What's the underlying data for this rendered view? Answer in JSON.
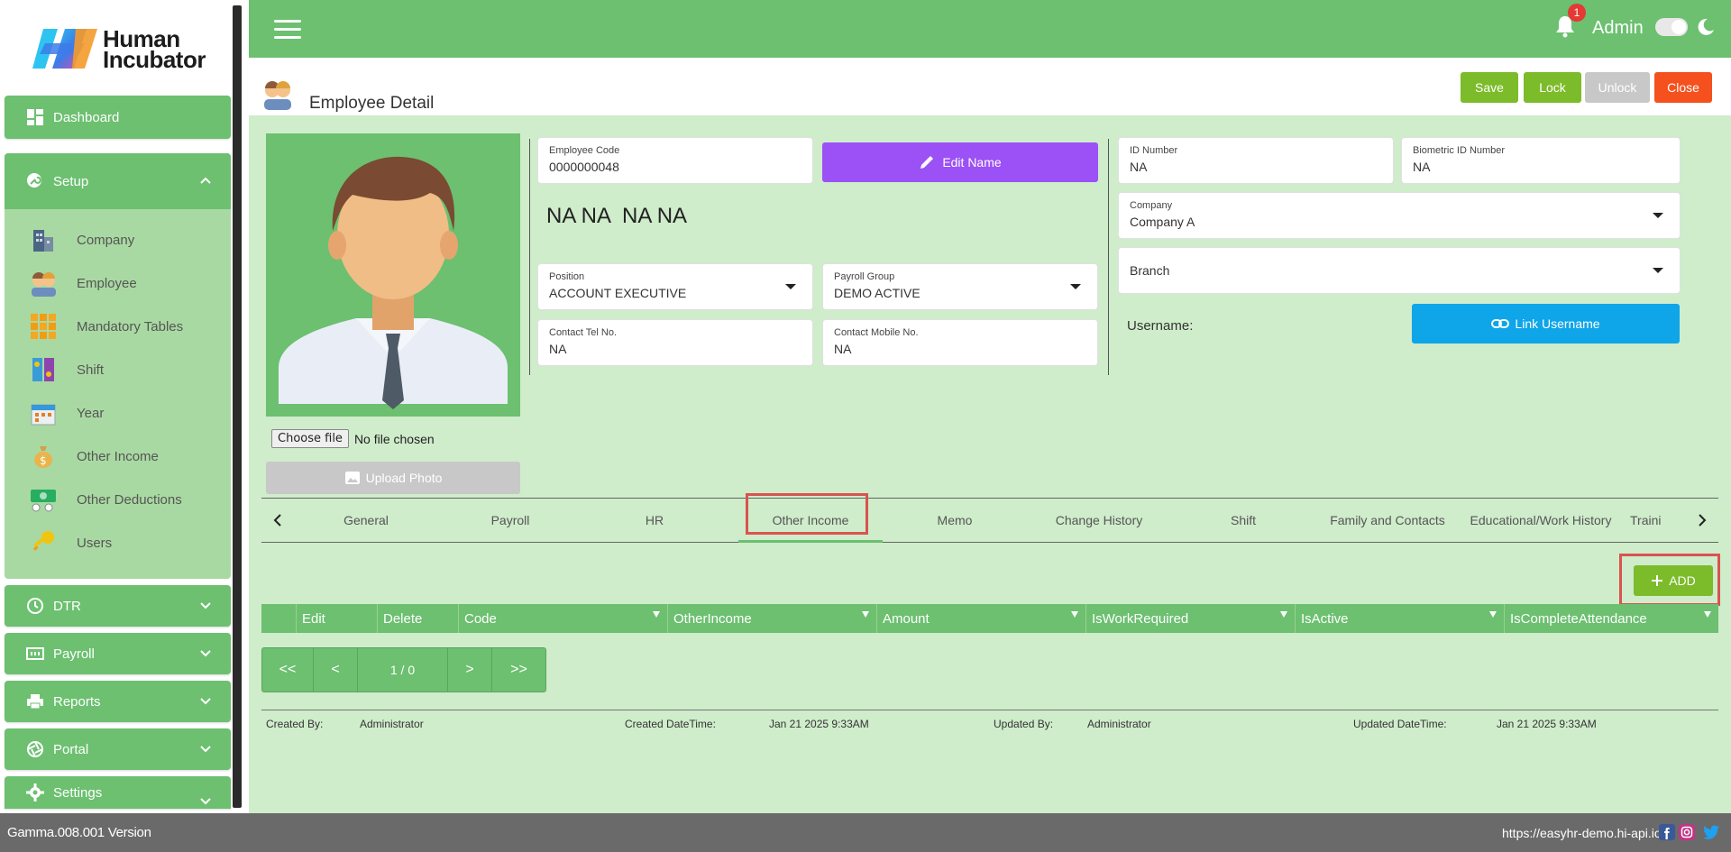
{
  "brand": {
    "name_line1": "Human",
    "name_line2": "Incubator"
  },
  "sidebar": {
    "dashboard": "Dashboard",
    "setup": "Setup",
    "setup_items": [
      "Company",
      "Employee",
      "Mandatory Tables",
      "Shift",
      "Year",
      "Other Income",
      "Other Deductions",
      "Users"
    ],
    "dtr": "DTR",
    "payroll": "Payroll",
    "reports": "Reports",
    "portal": "Portal",
    "settings": "Settings"
  },
  "topbar": {
    "notification_count": "1",
    "user": "Admin"
  },
  "page": {
    "title": "Employee Detail",
    "buttons": {
      "save": "Save",
      "lock": "Lock",
      "unlock": "Unlock",
      "close": "Close"
    }
  },
  "photo": {
    "choose_file": "Choose file",
    "file_status": "No file chosen",
    "upload": "Upload Photo"
  },
  "form": {
    "employee_code": {
      "label": "Employee Code",
      "value": "0000000048"
    },
    "edit_name": "Edit Name",
    "full_name": "NA NA  NA NA",
    "position": {
      "label": "Position",
      "value": "ACCOUNT EXECUTIVE"
    },
    "payroll_group": {
      "label": "Payroll Group",
      "value": "DEMO ACTIVE"
    },
    "contact_tel": {
      "label": "Contact Tel No.",
      "value": "NA"
    },
    "contact_mobile": {
      "label": "Contact Mobile No.",
      "value": "NA"
    },
    "id_number": {
      "label": "ID Number",
      "value": "NA"
    },
    "biometric_id": {
      "label": "Biometric ID Number",
      "value": "NA"
    },
    "company": {
      "label": "Company",
      "value": "Company A"
    },
    "branch": {
      "value": "Branch"
    },
    "username_label": "Username:",
    "link_username": "Link Username"
  },
  "tabs": [
    "General",
    "Payroll",
    "HR",
    "Other Income",
    "Memo",
    "Change History",
    "Shift",
    "Family and Contacts",
    "Educational/Work History",
    "Traini"
  ],
  "active_tab": "Other Income",
  "add_button": "ADD",
  "grid": {
    "columns": [
      "Edit",
      "Delete",
      "Code",
      "OtherIncome",
      "Amount",
      "IsWorkRequired",
      "IsActive",
      "IsCompleteAttendance"
    ]
  },
  "pager": {
    "first": "<<",
    "prev": "<",
    "page": "1 / 0",
    "next": ">",
    "last": ">>"
  },
  "audit": {
    "created_by_label": "Created By:",
    "created_by": "Administrator",
    "created_dt_label": "Created DateTime:",
    "created_dt": "Jan 21 2025 9:33AM",
    "updated_by_label": "Updated By:",
    "updated_by": "Administrator",
    "updated_dt_label": "Updated DateTime:",
    "updated_dt": "Jan 21 2025 9:33AM"
  },
  "footer": {
    "version": "Gamma.008.001 Version",
    "url": "https://easyhr-demo.hi-api.io"
  },
  "colors": {
    "primary_green": "#6cc070",
    "panel_green": "#cfeccb",
    "purple": "#9b51f5",
    "blue": "#0ea5e9",
    "red": "#f4511e",
    "highlight": "#d9534f"
  }
}
